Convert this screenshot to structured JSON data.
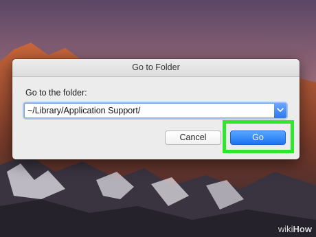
{
  "dialog": {
    "title": "Go to Folder",
    "prompt": "Go to the folder:",
    "path_value": "~/Library/Application Support/",
    "cancel_label": "Cancel",
    "go_label": "Go"
  },
  "highlight_color": "#2ee62e",
  "accent_color": "#1b74f1",
  "watermark": {
    "part1": "wiki",
    "part2": "How"
  }
}
